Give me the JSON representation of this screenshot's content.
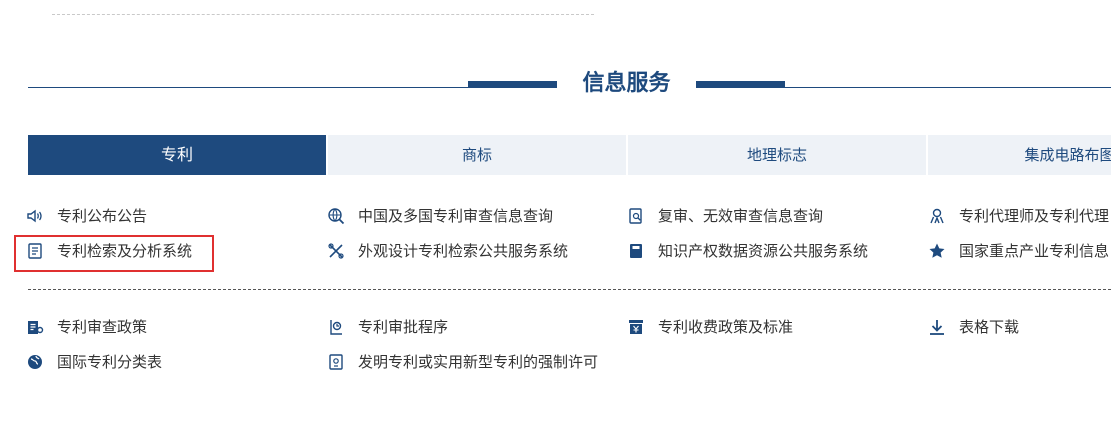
{
  "section": {
    "title": "信息服务"
  },
  "tabs": [
    {
      "label": "专利"
    },
    {
      "label": "商标"
    },
    {
      "label": "地理标志"
    },
    {
      "label": "集成电路布图设"
    }
  ],
  "row1": [
    {
      "label": "专利公布公告",
      "icon": "speaker-icon"
    },
    {
      "label": "中国及多国专利审查信息查询",
      "icon": "globe-search-icon"
    },
    {
      "label": "复审、无效审查信息查询",
      "icon": "document-search-icon"
    },
    {
      "label": "专利代理师及专利代理",
      "icon": "person-icon"
    }
  ],
  "row2": [
    {
      "label": "专利检索及分析系统",
      "icon": "document-list-icon"
    },
    {
      "label": "外观设计专利检索公共服务系统",
      "icon": "tools-icon"
    },
    {
      "label": "知识产权数据资源公共服务系统",
      "icon": "database-icon"
    },
    {
      "label": "国家重点产业专利信息",
      "icon": "star-icon"
    }
  ],
  "row3": [
    {
      "label": "专利审查政策",
      "icon": "policy-icon"
    },
    {
      "label": "专利审批程序",
      "icon": "process-icon"
    },
    {
      "label": "专利收费政策及标准",
      "icon": "fee-icon"
    },
    {
      "label": "表格下载",
      "icon": "download-icon"
    }
  ],
  "row4": [
    {
      "label": "国际专利分类表",
      "icon": "earth-icon"
    },
    {
      "label": "发明专利或实用新型专利的强制许可",
      "icon": "license-icon"
    }
  ],
  "colors": {
    "primary": "#1e4a7e",
    "tab_bg": "#eef2f7",
    "highlight": "#e03030"
  }
}
